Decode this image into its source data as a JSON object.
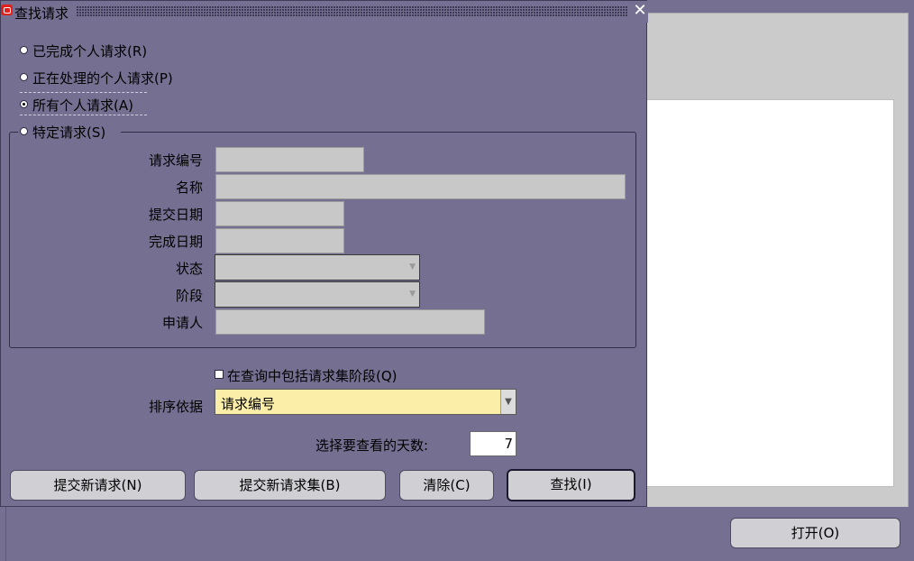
{
  "dialog": {
    "title": "查找请求",
    "radios": [
      {
        "label": "已完成个人请求(R)",
        "selected": false
      },
      {
        "label": "正在处理的个人请求(P)",
        "selected": false
      },
      {
        "label": "所有个人请求(A)",
        "selected": true
      },
      {
        "label": "特定请求(S)",
        "selected": false
      }
    ],
    "fields": {
      "request_id": {
        "label": "请求编号",
        "value": ""
      },
      "name": {
        "label": "名称",
        "value": ""
      },
      "submit_date": {
        "label": "提交日期",
        "value": ""
      },
      "complete_date": {
        "label": "完成日期",
        "value": ""
      },
      "status": {
        "label": "状态",
        "value": ""
      },
      "phase": {
        "label": "阶段",
        "value": ""
      },
      "requester": {
        "label": "申请人",
        "value": ""
      }
    },
    "include_set_stages": {
      "label": "在查询中包括请求集阶段(Q)",
      "checked": false
    },
    "sort": {
      "label": "排序依据",
      "value": "请求编号"
    },
    "days": {
      "label": "选择要查看的天数:",
      "value": "7"
    },
    "buttons": {
      "submit_new": "提交新请求(N)",
      "submit_new_set": "提交新请求集(B)",
      "clear": "清除(C)",
      "find": "查找(I)"
    }
  },
  "background": {
    "open_button": "打开(O)"
  },
  "colors": {
    "window_bg": "#756f91",
    "field_bg": "#c8c8c8",
    "sort_field_bg": "#fbeea8",
    "close_icon": "#ffffff",
    "app_icon": "#e0201c"
  }
}
